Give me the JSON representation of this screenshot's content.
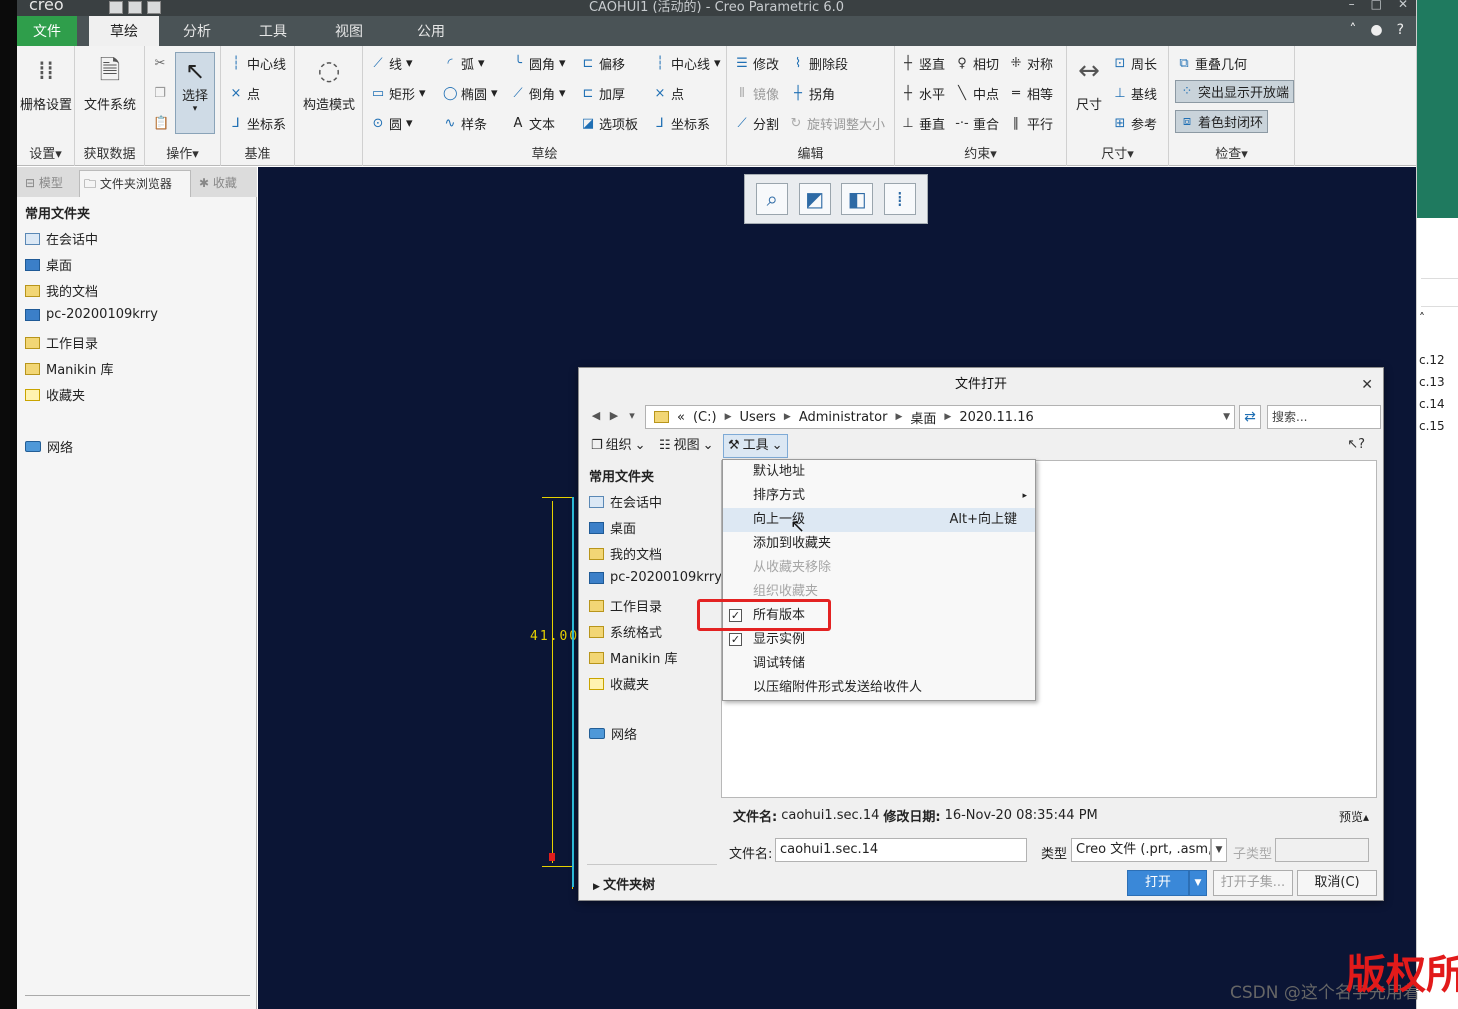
{
  "titlebar": {
    "logo": "creo",
    "title": "CAOHUI1 (活动的) - Creo Parametric 6.0"
  },
  "ribbon_tabs": [
    "文件",
    "草绘",
    "分析",
    "工具",
    "视图",
    "公用"
  ],
  "ribbon": {
    "settings": {
      "grid": "栅格设置",
      "label": "设置▾"
    },
    "getdata": {
      "filesystem": "文件系统",
      "label": "获取数据"
    },
    "operations": {
      "select": "选择",
      "label": "操作▾"
    },
    "datum": {
      "centerline": "中心线",
      "point": "点",
      "coordsys": "坐标系",
      "label": "基准"
    },
    "construction": {
      "mode": "构造模式"
    },
    "sketch": {
      "line": "线",
      "arc": "弧",
      "fillet": "圆角",
      "offset": "偏移",
      "centerline": "中心线",
      "rectangle": "矩形",
      "ellipse": "椭圆",
      "chamfer": "倒角",
      "thicken": "加厚",
      "point": "点",
      "circle": "圆",
      "spline": "样条",
      "text": "文本",
      "palette": "选项板",
      "coordsys": "坐标系",
      "label": "草绘"
    },
    "edit": {
      "modify": "修改",
      "delete_segment": "删除段",
      "mirror": "镜像",
      "corner": "拐角",
      "divide": "分割",
      "rotate_resize": "旋转调整大小",
      "label": "编辑"
    },
    "constrain": {
      "vertical": "竖直",
      "tangent": "相切",
      "symmetric": "对称",
      "horizontal": "水平",
      "midpoint": "中点",
      "equal": "相等",
      "perpendicular": "垂直",
      "coincident": "重合",
      "parallel": "平行",
      "label": "约束▾"
    },
    "dimension": {
      "dimension": "尺寸",
      "perimeter": "周长",
      "baseline": "基线",
      "reference": "参考",
      "label": "尺寸▾"
    },
    "inspect": {
      "overlap": "重叠几何",
      "highlight_open": "突出显示开放端",
      "shade_closed": "着色封闭环",
      "label": "检查▾"
    }
  },
  "navigator": {
    "tabs": [
      "模型",
      "文件夹浏览器",
      "收藏"
    ],
    "section": "常用文件夹",
    "items": [
      "在会话中",
      "桌面",
      "我的文档",
      "pc-20200109krry",
      "工作目录",
      "Manikin 库",
      "收藏夹",
      "网络"
    ]
  },
  "canvas": {
    "dimension_text": "41.00"
  },
  "right_strip": [
    "c.12",
    "c.13",
    "c.14",
    "c.15"
  ],
  "dialog": {
    "title": "文件打开",
    "address": {
      "crumbs": [
        "(C:)",
        "Users",
        "Administrator",
        "桌面",
        "2020.11.16"
      ],
      "search_placeholder": "搜索..."
    },
    "toolbar": {
      "organize": "组织",
      "views": "视图",
      "tools": "工具"
    },
    "left": {
      "section": "常用文件夹",
      "items": [
        "在会话中",
        "桌面",
        "我的文档",
        "pc-20200109krry",
        "工作目录",
        "系统格式",
        "Manikin 库",
        "收藏夹",
        "网络"
      ],
      "folder_tree": "文件夹树"
    },
    "info": {
      "filename_label": "文件名:",
      "filename": "caohui1.sec.14",
      "date_label": "修改日期:",
      "date": "16-Nov-20 08:35:44 PM",
      "preview": "预览▴"
    },
    "filename_row": {
      "label": "文件名:",
      "value": "caohui1.sec.14",
      "type_label": "类型",
      "type_value": "Creo 文件 (.prt, .asm,",
      "subtype_label": "子类型"
    },
    "buttons": {
      "open": "打开",
      "open_sub": "打开子集...",
      "cancel": "取消(C)"
    }
  },
  "context_menu": {
    "items": [
      {
        "label": "默认地址",
        "state": "enabled"
      },
      {
        "label": "排序方式",
        "state": "enabled",
        "submenu": "▸"
      },
      {
        "label": "向上一级",
        "state": "hover",
        "shortcut": "Alt+向上键"
      },
      {
        "label": "添加到收藏夹",
        "state": "enabled"
      },
      {
        "label": "从收藏夹移除",
        "state": "disabled"
      },
      {
        "label": "组织收藏夹",
        "state": "disabled"
      },
      {
        "label": "所有版本",
        "state": "checked"
      },
      {
        "label": "显示实例",
        "state": "checked"
      },
      {
        "label": "调试转储",
        "state": "enabled"
      },
      {
        "label": "以压缩附件形式发送给收件人",
        "state": "enabled"
      }
    ]
  },
  "overlay": {
    "csdn": "CSDN @这个名字先用着",
    "copyright": "版权所"
  },
  "colors": {
    "accent_green": "#2f9e4b",
    "canvas": "#0b1535",
    "highlight_red": "#e32222"
  }
}
